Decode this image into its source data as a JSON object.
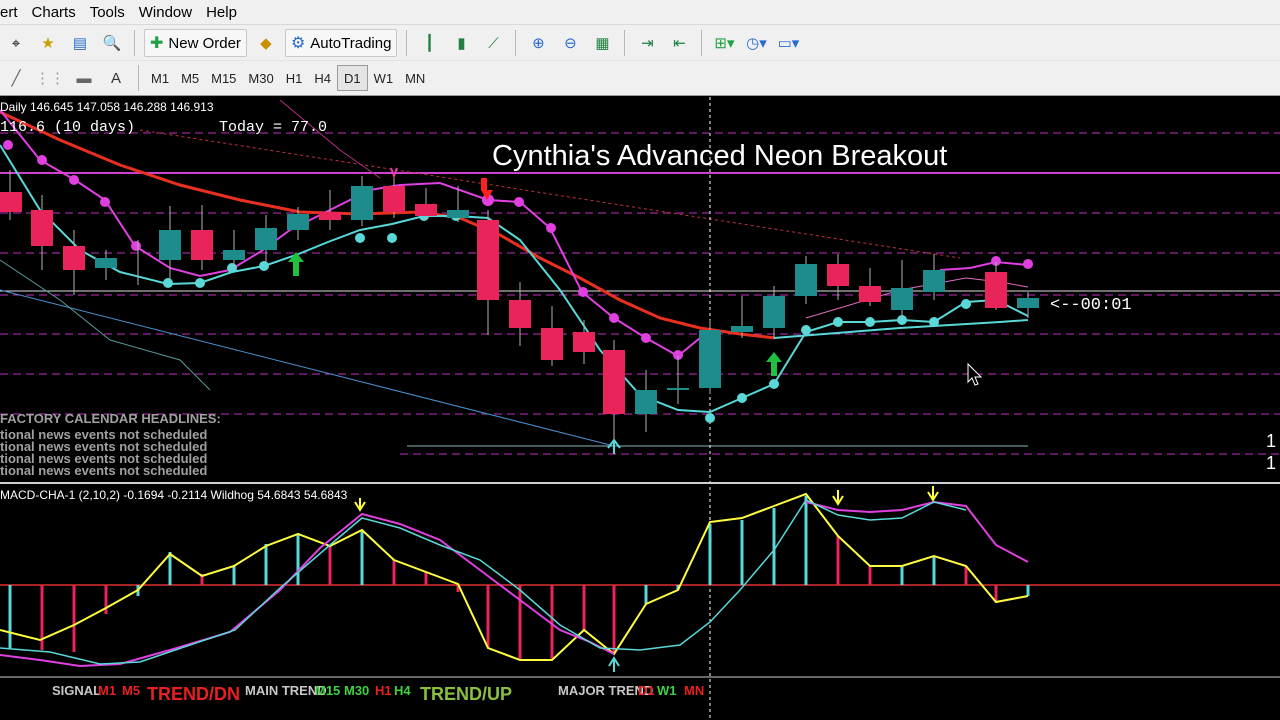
{
  "menu": [
    "ert",
    "Charts",
    "Tools",
    "Window",
    "Help"
  ],
  "toolbar": {
    "new_order_label": "New Order",
    "autotrading_label": "AutoTrading"
  },
  "timeframes": [
    "M1",
    "M5",
    "M15",
    "M30",
    "H1",
    "H4",
    "D1",
    "W1",
    "MN"
  ],
  "active_timeframe": "D1",
  "chart": {
    "header_ohlc": "Daily  146.645 147.058 146.288 146.913",
    "range_text": " 116.6  (10 days)",
    "today_text": "Today = 77.0",
    "title": "Cynthia's Advanced Neon Breakout",
    "countdown": "<--00:01",
    "right_edge_1": "1",
    "right_edge_2": "1"
  },
  "calendar": {
    "heading": "FACTORY CALENDAR HEADLINES:",
    "lines": [
      "tional news events not scheduled",
      "tional news events not scheduled",
      "tional news events not scheduled",
      "tional news events not scheduled"
    ]
  },
  "indicator": {
    "label": "MACD-CHA-1 (2,10,2)  -0.1694 -0.2114   Wildhog 54.6843 54.6843"
  },
  "status": {
    "signal_label": "SIGNAL",
    "signal_tf_1": "M1",
    "signal_tf_2": "M5",
    "signal_trend": "TREND/DN",
    "main_label": "MAIN TREND",
    "main_tf_1": "M15",
    "main_tf_2": "M30",
    "main_tf_3": "H1",
    "main_tf_4": "H4",
    "main_trend": "TREND/UP",
    "major_label": "MAJOR TREND",
    "major_tf_1": "D1",
    "major_tf_2": "W1",
    "major_tf_3": "MN"
  },
  "colors": {
    "bull": "#1e8c8c",
    "bear": "#e8245a",
    "magenta": "#e040e0",
    "cyan": "#5ad8d8",
    "red_ma": "#e83020",
    "yellow": "#ffff40",
    "green_arrow": "#20c040"
  }
}
